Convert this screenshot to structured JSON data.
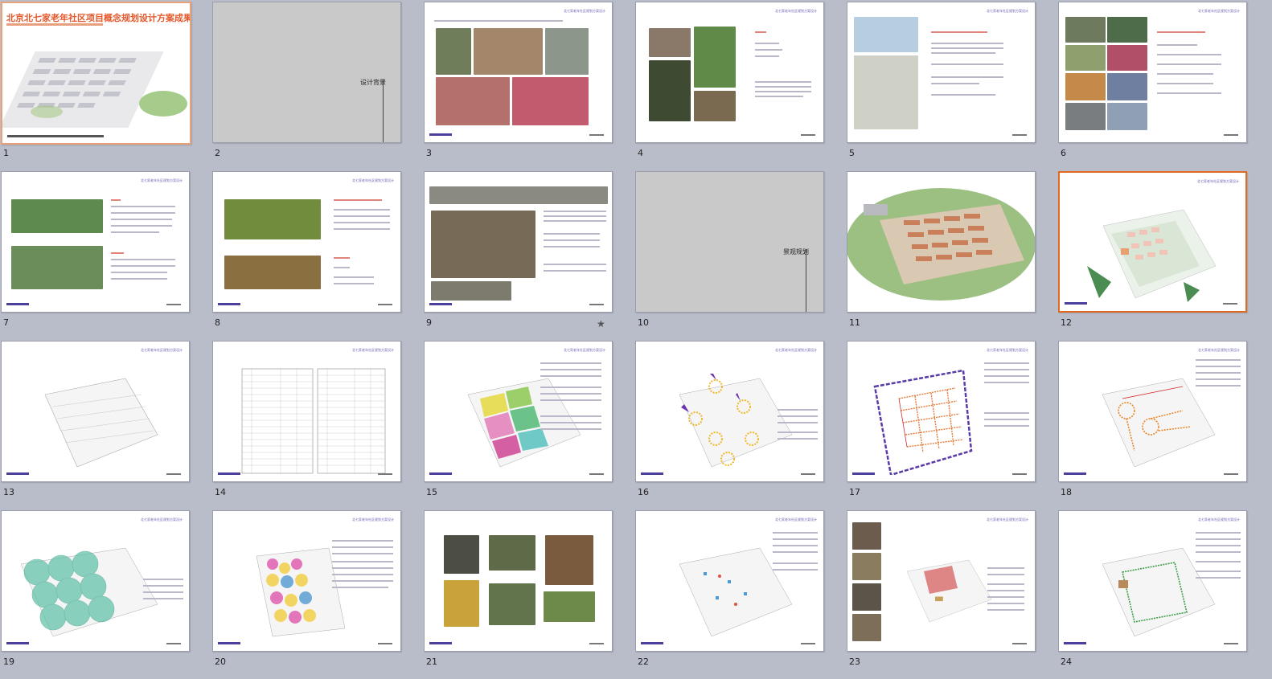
{
  "slides": [
    {
      "num": "1",
      "title": "北京北七家老年社区项目概念规划设计方案成果",
      "kind": "cover"
    },
    {
      "num": "2",
      "label": "设计背景",
      "kind": "section"
    },
    {
      "num": "3",
      "kind": "photos"
    },
    {
      "num": "4",
      "kind": "photos"
    },
    {
      "num": "5",
      "kind": "maps"
    },
    {
      "num": "6",
      "kind": "photos"
    },
    {
      "num": "7",
      "kind": "photos"
    },
    {
      "num": "8",
      "kind": "photos"
    },
    {
      "num": "9",
      "kind": "site"
    },
    {
      "num": "10",
      "label": "景观规划",
      "kind": "section"
    },
    {
      "num": "11",
      "kind": "render"
    },
    {
      "num": "12",
      "kind": "plan",
      "selected": true
    },
    {
      "num": "13",
      "kind": "plan"
    },
    {
      "num": "14",
      "kind": "table"
    },
    {
      "num": "15",
      "kind": "plan"
    },
    {
      "num": "16",
      "kind": "plan"
    },
    {
      "num": "17",
      "kind": "plan"
    },
    {
      "num": "18",
      "kind": "plan"
    },
    {
      "num": "19",
      "kind": "plan"
    },
    {
      "num": "20",
      "kind": "plan"
    },
    {
      "num": "21",
      "kind": "photos"
    },
    {
      "num": "22",
      "kind": "plan"
    },
    {
      "num": "23",
      "kind": "plan"
    },
    {
      "num": "24",
      "kind": "plan"
    }
  ],
  "header_text": "北七家老年社区规划方案设计",
  "colors": {
    "selected_border": "#e06a1f",
    "background": "#b9bcc9",
    "accent": "#6a5bb0"
  },
  "icons": {
    "animation": "star-icon"
  }
}
